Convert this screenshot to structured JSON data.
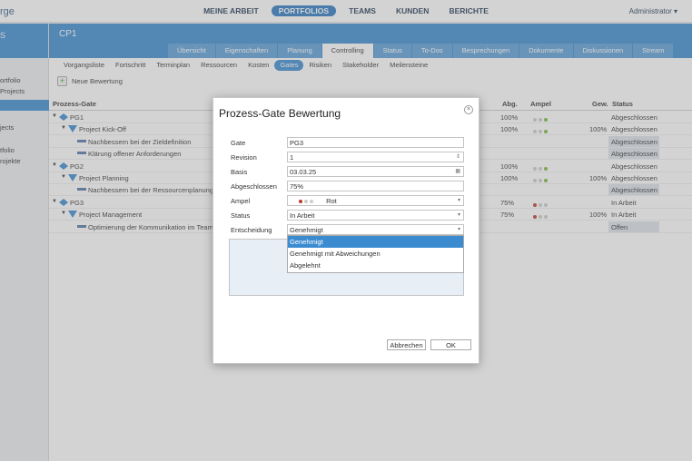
{
  "app": {
    "logo": "rge",
    "admin": "Administrator ▾"
  },
  "nav": [
    "MEINE ARBEIT",
    "PORTFOLIOS",
    "TEAMS",
    "KUNDEN",
    "BERICHTE"
  ],
  "sidebar": {
    "header": "S",
    "items": [
      "ortfolio",
      "Projects",
      "jects",
      "tfolio",
      "rojekte"
    ]
  },
  "project": {
    "title": "CP1"
  },
  "tabs": [
    "Übersicht",
    "Eigenschaften",
    "Planung",
    "Controlling",
    "Status",
    "To-Dos",
    "Besprechungen",
    "Dokumente",
    "Diskussionen",
    "Stream"
  ],
  "subtabs": [
    "Vorgangsliste",
    "Fortschritt",
    "Terminplan",
    "Ressourcen",
    "Kosten",
    "Gates",
    "Risiken",
    "Stakeholder",
    "Meilensteine"
  ],
  "new_button": "Neue Bewertung",
  "table": {
    "headers": {
      "gate": "Prozess-Gate",
      "abg": "Abg.",
      "ampel": "Ampel",
      "gew": "Gew.",
      "status": "Status"
    },
    "rows": [
      {
        "name": "PG1",
        "abg": "100%",
        "gew": "",
        "status": "Abgeschlossen",
        "ampel": [
          "#ccc",
          "#ccc",
          "#7ab83c"
        ]
      },
      {
        "name": "Project Kick-Off",
        "abg": "100%",
        "gew": "100%",
        "status": "Abgeschlossen",
        "ampel": [
          "#ccc",
          "#ccc",
          "#7ab83c"
        ]
      },
      {
        "name": "Nachbessern bei der Zieldefinition",
        "abg": "",
        "gew": "",
        "status": "Abgeschlossen"
      },
      {
        "name": "Klärung offener Anforderungen",
        "abg": "",
        "gew": "",
        "status": "Abgeschlossen"
      },
      {
        "name": "PG2",
        "abg": "100%",
        "gew": "",
        "status": "Abgeschlossen",
        "ampel": [
          "#ccc",
          "#ccc",
          "#7ab83c"
        ]
      },
      {
        "name": "Project Planning",
        "abg": "100%",
        "gew": "100%",
        "status": "Abgeschlossen",
        "ampel": [
          "#ccc",
          "#ccc",
          "#7ab83c"
        ]
      },
      {
        "name": "Nachbessern bei der Ressourcenplanung",
        "abg": "",
        "gew": "",
        "status": "Abgeschlossen"
      },
      {
        "name": "PG3",
        "abg": "75%",
        "gew": "",
        "status": "In Arbeit",
        "ampel": [
          "#c0392b",
          "#ccc",
          "#ccc"
        ]
      },
      {
        "name": "Project Management",
        "abg": "75%",
        "gew": "100%",
        "status": "In Arbeit",
        "ampel": [
          "#c0392b",
          "#ccc",
          "#ccc"
        ]
      },
      {
        "name": "Optimierung der Kommunikation im Team",
        "abg": "",
        "gew": "",
        "status": "Offen"
      }
    ]
  },
  "dialog": {
    "title": "Prozess-Gate Bewertung",
    "fields": {
      "gate": {
        "label": "Gate",
        "value": "PG3"
      },
      "revision": {
        "label": "Revision",
        "value": "1"
      },
      "basis": {
        "label": "Basis",
        "value": "03.03.25"
      },
      "abgeschlossen": {
        "label": "Abgeschlossen",
        "value": "75%"
      },
      "ampel": {
        "label": "Ampel",
        "value": "Rot"
      },
      "status": {
        "label": "Status",
        "value": "In Arbeit"
      },
      "entscheidung": {
        "label": "Entscheidung",
        "value": "Genehmigt"
      }
    },
    "dropdown_options": [
      "Genehmigt",
      "Genehmigt mit Abweichungen",
      "Abgelehnt"
    ],
    "cancel": "Abbrechen",
    "ok": "OK"
  },
  "colors": {
    "accent": "#3b8bd0",
    "nav_active": "#2c79c2",
    "green": "#7ab83c",
    "red": "#c0392b"
  }
}
